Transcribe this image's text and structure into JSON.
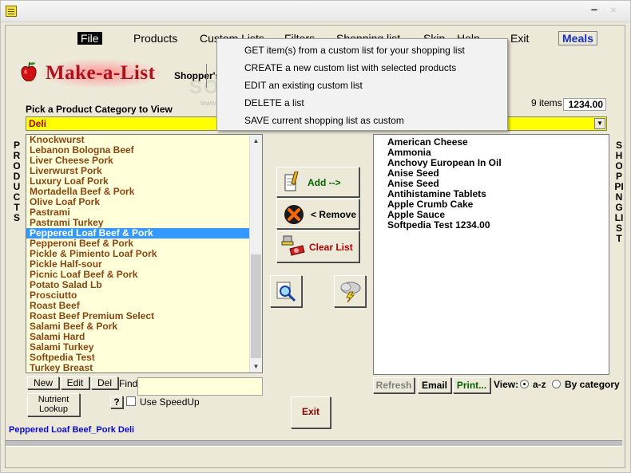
{
  "menubar": {
    "items": [
      "File",
      "Products",
      "Custom Lists",
      "Filters",
      "Shopping list",
      "Skip",
      "Help",
      "Exit"
    ],
    "meals": "Meals"
  },
  "header": {
    "title": "Make-a-List",
    "subtitle": "Shopper's"
  },
  "category": {
    "label": "Pick a Product Category to View",
    "value": "Deli"
  },
  "summary": {
    "item_count": "9 items",
    "total": "1234.00"
  },
  "side_labels": {
    "products": "PRODUCTS",
    "shopping": "SHOPPING LIST"
  },
  "products": [
    "Knockwurst",
    "Lebanon Bologna Beef",
    "Liver Cheese Pork",
    "Liverwurst Pork",
    "Luxury Loaf Pork",
    "Mortadella Beef & Pork",
    "Olive Loaf Pork",
    "Pastrami",
    "Pastrami Turkey",
    "Peppered Loaf Beef & Pork",
    "Pepperoni Beef & Pork",
    "Pickle & Pimiento Loaf Pork",
    "Pickle Half-sour",
    "Picnic Loaf Beef & Pork",
    "Potato Salad Lb",
    "Prosciutto",
    "Roast Beef",
    "Roast Beef Premium Select",
    "Salami Beef & Pork",
    "Salami Hard",
    "Salami Turkey",
    "Softpedia Test",
    "Turkey Breast"
  ],
  "selected_product": 9,
  "shopping_list": [
    "American Cheese",
    "Ammonia",
    "Anchovy European In Oil",
    "Anise Seed",
    "Anise Seed",
    "Antihistamine Tablets",
    "Apple Crumb Cake",
    "Apple Sauce",
    "Softpedia Test  1234.00"
  ],
  "buttons": {
    "add": "Add -->",
    "remove": "< Remove",
    "clear": "Clear List",
    "new": "New",
    "edit": "Edit",
    "del": "Del",
    "find": "Find",
    "nutrient_1": "Nutrient",
    "nutrient_2": "Lookup",
    "help": "?",
    "speedup": "Use SpeedUp",
    "exit": "Exit",
    "refresh": "Refresh",
    "email": "Email",
    "print": "Print..."
  },
  "view": {
    "label": "View:",
    "az": "a-z",
    "by_category": "By category",
    "selected": "a-z"
  },
  "status": "Peppered Loaf Beef_Pork   Deli",
  "dropdown_menu": [
    "GET item(s) from a custom list for your shopping list",
    "CREATE a new custom list with selected products",
    "EDIT an existing custom list",
    "DELETE a list",
    "SAVE current shopping list as custom"
  ],
  "watermark": {
    "main": "SOFTPEDIA",
    "sub": "www.softpedia.com"
  },
  "colors": {
    "product_text": "#8b4513",
    "selection": "#3399ff",
    "category_bg": "#ffff00",
    "brand_red": "#b0101c",
    "status_blue": "#0a0ad0"
  }
}
